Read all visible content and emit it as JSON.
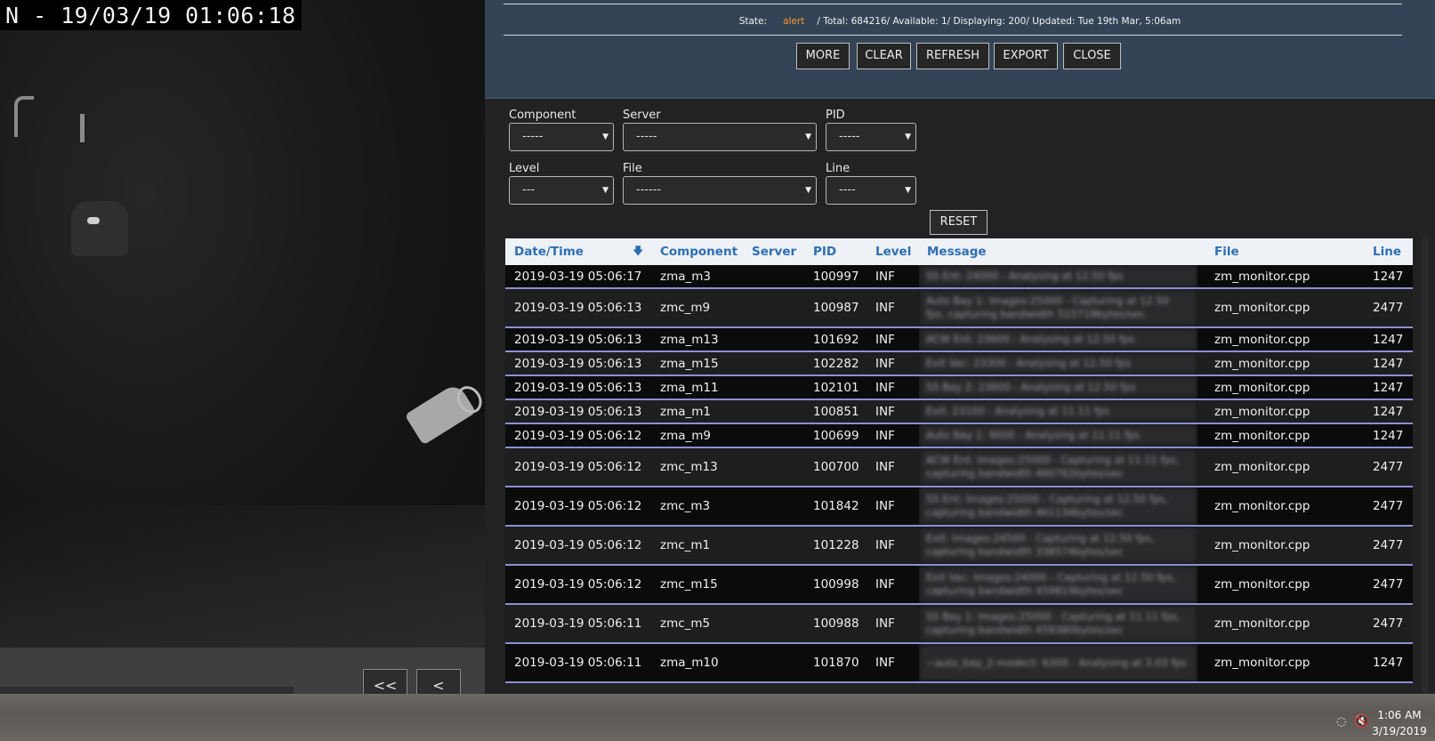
{
  "camera": {
    "timestamp": "N - 19/03/19 01:06:18"
  },
  "playback_controls": {
    "first_label": "<<",
    "prev_label": "<"
  },
  "log": {
    "state_label": "State:",
    "state_value": "alert",
    "summary": "/ Total: 684216/ Available: 1/ Displaying: 200/ Updated: Tue 19th Mar, 5:06am",
    "buttons": {
      "more": "MORE",
      "clear": "CLEAR",
      "refresh": "REFRESH",
      "export": "EXPORT",
      "close": "CLOSE"
    },
    "filters": {
      "component": {
        "label": "Component",
        "value": "-----"
      },
      "server": {
        "label": "Server",
        "value": "-----"
      },
      "pid": {
        "label": "PID",
        "value": "-----"
      },
      "level": {
        "label": "Level",
        "value": "---"
      },
      "file": {
        "label": "File",
        "value": "------"
      },
      "line": {
        "label": "Line",
        "value": "----"
      },
      "reset_label": "RESET"
    },
    "columns": {
      "datetime": "Date/Time",
      "component": "Component",
      "server": "Server",
      "pid": "PID",
      "level": "Level",
      "message": "Message",
      "file": "File",
      "line": "Line"
    },
    "rows": [
      {
        "datetime": "2019-03-19 05:06:17",
        "component": "zma_m3",
        "server": "",
        "pid": "100997",
        "level": "INF",
        "message": "SS Ent: 24000 - Analysing at 12.50 fps",
        "file": "zm_monitor.cpp",
        "line": "1247",
        "tall": false
      },
      {
        "datetime": "2019-03-19 05:06:13",
        "component": "zmc_m9",
        "server": "",
        "pid": "100987",
        "level": "INF",
        "message": "Auto Bay 1: Images:25000 - Capturing at 12.50 fps, capturing bandwidth 515719bytes/sec",
        "file": "zm_monitor.cpp",
        "line": "2477",
        "tall": true
      },
      {
        "datetime": "2019-03-19 05:06:13",
        "component": "zma_m13",
        "server": "",
        "pid": "101692",
        "level": "INF",
        "message": "ACW Ent: 23600 - Analysing at 12.50 fps",
        "file": "zm_monitor.cpp",
        "line": "1247",
        "tall": false
      },
      {
        "datetime": "2019-03-19 05:06:13",
        "component": "zma_m15",
        "server": "",
        "pid": "102282",
        "level": "INF",
        "message": "Exit Vac: 23300 - Analysing at 12.50 fps",
        "file": "zm_monitor.cpp",
        "line": "1247",
        "tall": false
      },
      {
        "datetime": "2019-03-19 05:06:13",
        "component": "zma_m11",
        "server": "",
        "pid": "102101",
        "level": "INF",
        "message": "SS Bay 2: 23600 - Analysing at 12.50 fps",
        "file": "zm_monitor.cpp",
        "line": "1247",
        "tall": false
      },
      {
        "datetime": "2019-03-19 05:06:13",
        "component": "zma_m1",
        "server": "",
        "pid": "100851",
        "level": "INF",
        "message": "Exit: 23100 - Analysing at 11.11 fps",
        "file": "zm_monitor.cpp",
        "line": "1247",
        "tall": false
      },
      {
        "datetime": "2019-03-19 05:06:12",
        "component": "zma_m9",
        "server": "",
        "pid": "100699",
        "level": "INF",
        "message": "Auto Bay 1: 9000 - Analysing at 11.11 fps",
        "file": "zm_monitor.cpp",
        "line": "1247",
        "tall": false
      },
      {
        "datetime": "2019-03-19 05:06:12",
        "component": "zmc_m13",
        "server": "",
        "pid": "100700",
        "level": "INF",
        "message": "ACW Ent: Images:25000 - Capturing at 11.11 fps, capturing bandwidth 460762bytes/sec",
        "file": "zm_monitor.cpp",
        "line": "2477",
        "tall": true
      },
      {
        "datetime": "2019-03-19 05:06:12",
        "component": "zmc_m3",
        "server": "",
        "pid": "101842",
        "level": "INF",
        "message": "SS Ent: Images:25000 - Capturing at 12.50 fps, capturing bandwidth 461134bytes/sec",
        "file": "zm_monitor.cpp",
        "line": "2477",
        "tall": true
      },
      {
        "datetime": "2019-03-19 05:06:12",
        "component": "zmc_m1",
        "server": "",
        "pid": "101228",
        "level": "INF",
        "message": "Exit: Images:24500 - Capturing at 12.50 fps, capturing bandwidth 338574bytes/sec",
        "file": "zm_monitor.cpp",
        "line": "2477",
        "tall": true
      },
      {
        "datetime": "2019-03-19 05:06:12",
        "component": "zmc_m15",
        "server": "",
        "pid": "100998",
        "level": "INF",
        "message": "Exit Vac: Images:24000 - Capturing at 12.50 fps, capturing bandwidth 459819bytes/sec",
        "file": "zm_monitor.cpp",
        "line": "2477",
        "tall": true
      },
      {
        "datetime": "2019-03-19 05:06:11",
        "component": "zmc_m5",
        "server": "",
        "pid": "100988",
        "level": "INF",
        "message": "SS Bay 1: Images:25000 - Capturing at 11.11 fps, capturing bandwidth 459380bytes/sec",
        "file": "zm_monitor.cpp",
        "line": "2477",
        "tall": true
      },
      {
        "datetime": "2019-03-19 05:06:11",
        "component": "zma_m10",
        "server": "",
        "pid": "101870",
        "level": "INF",
        "message": "~auto_bay_2-modect: 6300 - Analysing at 3.03 fps",
        "file": "zm_monitor.cpp",
        "line": "1247",
        "tall": true
      }
    ]
  },
  "taskbar": {
    "time": "1:06 AM",
    "date": "3/19/2019"
  }
}
